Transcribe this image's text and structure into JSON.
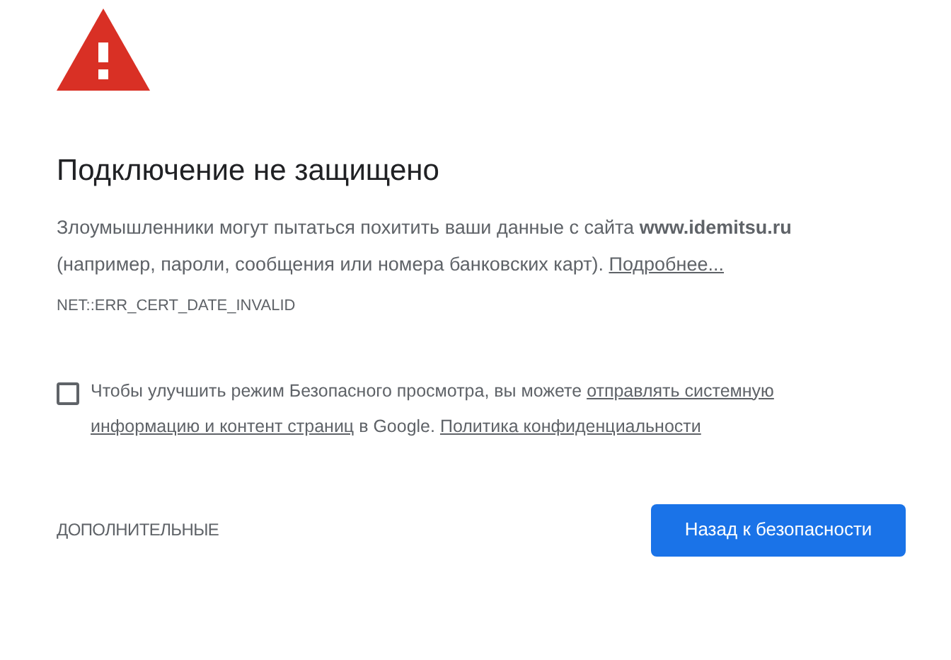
{
  "heading": "Подключение не защищено",
  "message": {
    "text": "Злоумышленники могут пытаться похитить ваши данные с сайта **www.idemitsu.ru** (например, пароли, сообщения или номера банковских карт).",
    "link": "Подробнее..."
  },
  "error_code": "NET::ERR_CERT_DATE_INVALID",
  "opt_in": {
    "checked": false,
    "segments": [
      {
        "kind": "text",
        "text": "Чтобы улучшить режим Безопасного просмотра, вы можете"
      },
      {
        "kind": "link",
        "text": "отправлять системную"
      },
      {
        "kind": "link",
        "text": "информацию и контент страниц"
      },
      {
        "kind": "text",
        "text": "в Google."
      },
      {
        "kind": "link",
        "text": "Политика конфиденциальности"
      }
    ]
  },
  "details_button": "ДОПОЛНИТЕЛЬНЫЕ",
  "primary_button": "Назад к безопасности"
}
